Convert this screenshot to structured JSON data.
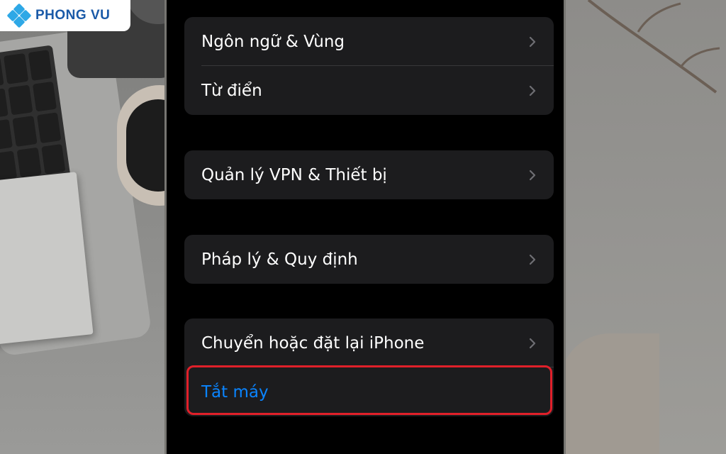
{
  "brand": {
    "logo_text": "PHONG VU"
  },
  "settings": {
    "group1": [
      {
        "label": "Ngôn ngữ & Vùng",
        "icon": "chevron-right-icon"
      },
      {
        "label": "Từ điển",
        "icon": "chevron-right-icon"
      }
    ],
    "group2": [
      {
        "label": "Quản lý VPN & Thiết bị",
        "icon": "chevron-right-icon"
      }
    ],
    "group3": [
      {
        "label": "Pháp lý & Quy định",
        "icon": "chevron-right-icon"
      }
    ],
    "group4": [
      {
        "label": "Chuyển hoặc đặt lại iPhone",
        "icon": "chevron-right-icon"
      },
      {
        "label": "Tắt máy"
      }
    ]
  },
  "colors": {
    "screen_bg": "#000000",
    "cell_bg": "#1c1c1e",
    "text": "#ffffff",
    "action_blue": "#0a84ff",
    "highlight_border": "#e0202a",
    "brand_blue": "#1a5aa8"
  }
}
